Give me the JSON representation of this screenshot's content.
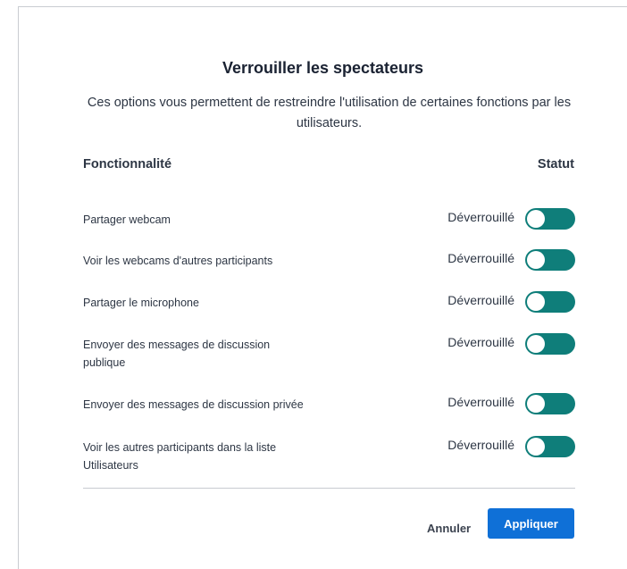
{
  "modal": {
    "title": "Verrouiller les spectateurs",
    "description": "Ces options vous permettent de restreindre l'utilisation de certaines fonctions par les utilisateurs."
  },
  "table": {
    "feature_header": "Fonctionnalité",
    "status_header": "Statut",
    "rows": [
      {
        "label": "Partager webcam",
        "status": "Déverrouillé",
        "locked": false
      },
      {
        "label": "Voir les webcams d'autres participants",
        "status": "Déverrouillé",
        "locked": false
      },
      {
        "label": "Partager le microphone",
        "status": "Déverrouillé",
        "locked": false
      },
      {
        "label": "Envoyer des messages de discussion publique",
        "status": "Déverrouillé",
        "locked": false
      },
      {
        "label": "Envoyer des messages de discussion privée",
        "status": "Déverrouillé",
        "locked": false
      },
      {
        "label": "Voir les autres participants dans la liste Utilisateurs",
        "status": "Déverrouillé",
        "locked": false
      }
    ]
  },
  "actions": {
    "cancel_label": "Annuler",
    "apply_label": "Appliquer"
  },
  "colors": {
    "toggle": "#0f7e7a",
    "primary": "#0f70d7"
  }
}
